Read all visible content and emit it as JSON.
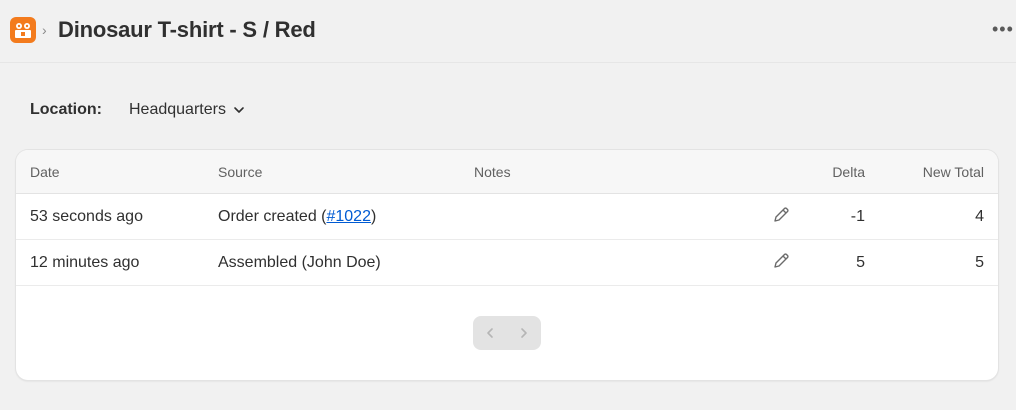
{
  "header": {
    "app_icon": "store-app-icon",
    "breadcrumb_separator": "›",
    "title": "Dinosaur T-shirt - S / Red",
    "more_icon": "ellipsis-horizontal-icon",
    "more_glyph": "•••"
  },
  "location": {
    "label": "Location:",
    "value": "Headquarters",
    "dropdown_icon": "chevron-down-icon"
  },
  "table": {
    "columns": {
      "date": "Date",
      "source": "Source",
      "notes": "Notes",
      "delta": "Delta",
      "new_total": "New Total"
    },
    "rows": [
      {
        "date": "53 seconds ago",
        "source_prefix": "Order created (",
        "source_link": "#1022",
        "source_suffix": ")",
        "notes": "",
        "edit_icon": "pencil-icon",
        "delta": "-1",
        "new_total": "4"
      },
      {
        "date": "12 minutes ago",
        "source": "Assembled (John Doe)",
        "notes": "",
        "edit_icon": "pencil-icon",
        "delta": "5",
        "new_total": "5"
      }
    ]
  },
  "pagination": {
    "prev_icon": "chevron-left-icon",
    "next_icon": "chevron-right-icon",
    "prev_disabled": true,
    "next_disabled": true
  },
  "colors": {
    "background": "#f1f1f1",
    "app_icon": "#f37b1d",
    "link": "#005bd3",
    "text": "#303030"
  }
}
